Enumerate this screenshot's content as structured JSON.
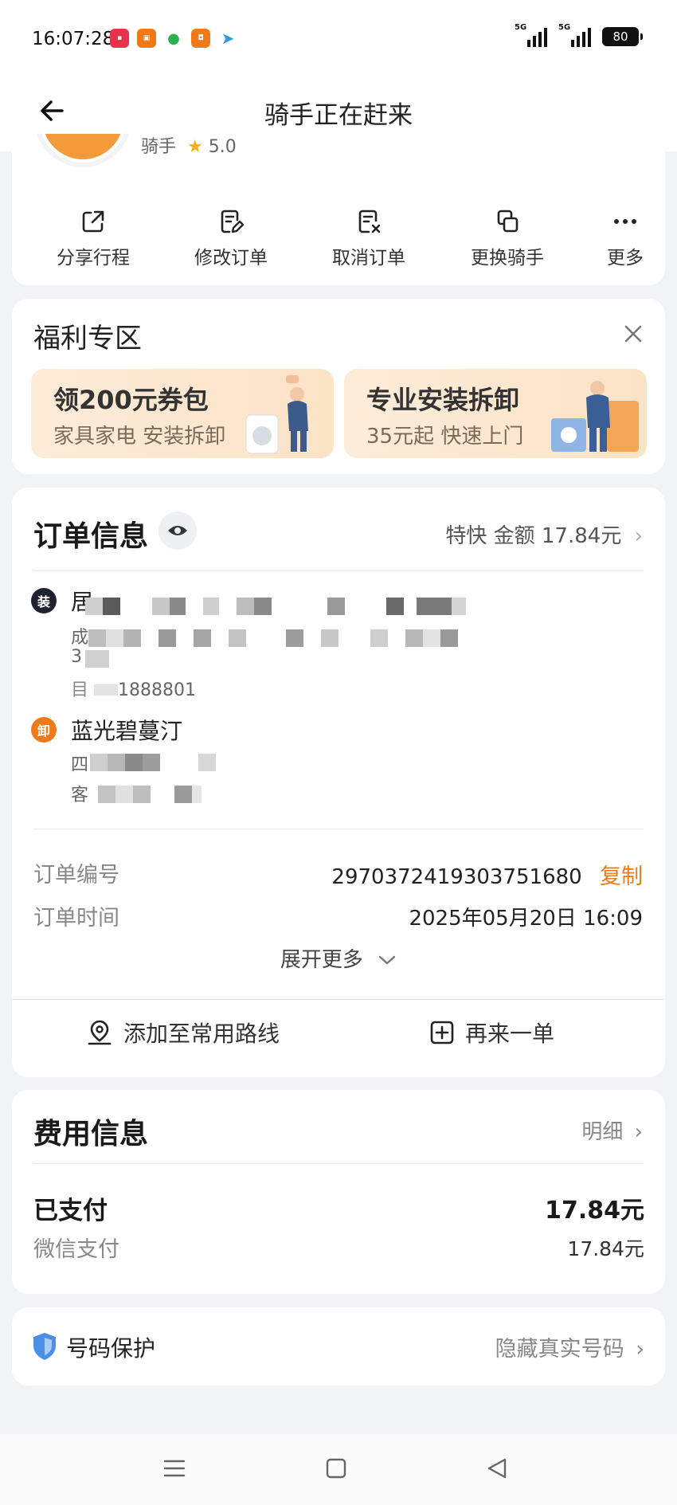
{
  "status_bar": {
    "time": "16:07:28",
    "signal_1": "5G",
    "signal_2": "5G",
    "battery": "80",
    "app_icons": [
      "xiaohongshu-icon",
      "app-icon-orange",
      "wechat-icon",
      "app-icon-orange-2",
      "telegram-icon"
    ]
  },
  "nav": {
    "title": "骑手正在赶来"
  },
  "rider": {
    "role_peek": "骑手",
    "rating": "5.0"
  },
  "actions": [
    {
      "label": "分享行程",
      "icon": "share-icon"
    },
    {
      "label": "修改订单",
      "icon": "edit-order-icon"
    },
    {
      "label": "取消订单",
      "icon": "cancel-order-icon"
    },
    {
      "label": "更换骑手",
      "icon": "switch-rider-icon"
    },
    {
      "label": "更多",
      "icon": "more-icon"
    }
  ],
  "promo": {
    "title": "福利专区",
    "banners": [
      {
        "title": "领200元券包",
        "subtitle": "家具家电 安装拆卸"
      },
      {
        "title": "专业安装拆卸",
        "subtitle": "35元起 快速上门"
      }
    ]
  },
  "order": {
    "title": "订单信息",
    "summary": "特快 金额 17.84元",
    "pickup": {
      "tag": "装",
      "name_visible": "居",
      "line2_visible": "成",
      "line3_visible": "3",
      "phone_visible": "1888801"
    },
    "dropoff": {
      "tag": "卸",
      "name": "蓝光碧蔓汀",
      "line2_visible": "四",
      "line3_visible": "客"
    },
    "order_no_label": "订单编号",
    "order_no": "2970372419303751680",
    "copy_label": "复制",
    "order_time_label": "订单时间",
    "order_time": "2025年05月20日 16:09",
    "expand_label": "展开更多",
    "add_route_label": "添加至常用路线",
    "reorder_label": "再来一单"
  },
  "fee": {
    "title": "费用信息",
    "detail_label": "明细",
    "paid_label": "已支付",
    "paid_amount": "17.84元",
    "method_label": "微信支付",
    "method_amount": "17.84元"
  },
  "protect": {
    "label": "号码保护",
    "action": "隐藏真实号码"
  },
  "colors": {
    "accent": "#ef7b14",
    "background": "#f2f3f5",
    "card": "#ffffff"
  }
}
